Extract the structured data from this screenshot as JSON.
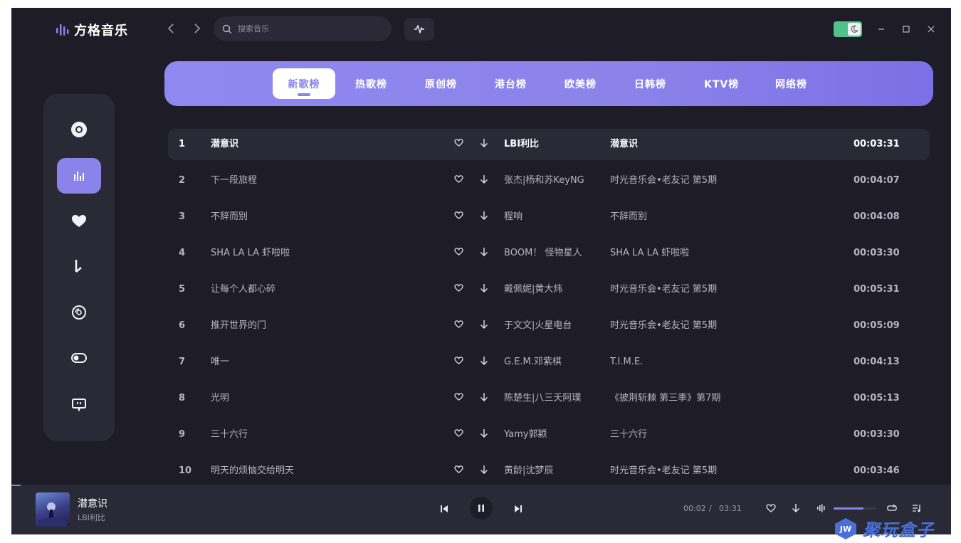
{
  "app": {
    "title": "方格音乐"
  },
  "search": {
    "placeholder": "搜索音乐"
  },
  "tabs": [
    "新歌榜",
    "热歌榜",
    "原创榜",
    "港台榜",
    "欧美榜",
    "日韩榜",
    "KTV榜",
    "网络榜"
  ],
  "active_tab": "新歌榜",
  "sidebar": {
    "items": [
      {
        "icon": "disc-icon"
      },
      {
        "icon": "chart-bars-icon",
        "active": true
      },
      {
        "icon": "heart-icon"
      },
      {
        "icon": "music-note-icon"
      },
      {
        "icon": "cd-icon"
      },
      {
        "icon": "toggle-icon"
      },
      {
        "icon": "bilibili-icon"
      }
    ]
  },
  "songs": [
    {
      "idx": "1",
      "title": "潜意识",
      "artist": "LBI利比",
      "album": "潜意识",
      "duration": "00:03:31",
      "current": true
    },
    {
      "idx": "2",
      "title": "下一段旅程",
      "artist": "张杰|杨和苏KeyNG",
      "album": "时光音乐会•老友记 第5期",
      "duration": "00:04:07"
    },
    {
      "idx": "3",
      "title": "不辞而别",
      "artist": "程响",
      "album": "不辞而别",
      "duration": "00:04:08"
    },
    {
      "idx": "4",
      "title": "SHA LA LA 虾啦啦",
      "artist": "BOOM！ 怪物星人",
      "album": "SHA LA LA 虾啦啦",
      "duration": "00:03:30"
    },
    {
      "idx": "5",
      "title": "让每个人都心碎",
      "artist": "戴佩妮|黄大炜",
      "album": "时光音乐会•老友记 第5期",
      "duration": "00:05:31"
    },
    {
      "idx": "6",
      "title": "推开世界的门",
      "artist": "于文文|火星电台",
      "album": "时光音乐会•老友记 第5期",
      "duration": "00:05:09"
    },
    {
      "idx": "7",
      "title": "唯一",
      "artist": "G.E.M.邓紫棋",
      "album": "T.I.M.E.",
      "duration": "00:04:13"
    },
    {
      "idx": "8",
      "title": "光明",
      "artist": "陈楚生|八三夭阿璞",
      "album": "《披荆斩棘 第三季》第7期",
      "duration": "00:05:13"
    },
    {
      "idx": "9",
      "title": "三十六行",
      "artist": "Yamy郭颖",
      "album": "三十六行",
      "duration": "00:03:30"
    },
    {
      "idx": "10",
      "title": "明天的烦恼交给明天",
      "artist": "黄龄|沈梦辰",
      "album": "时光音乐会•老友记 第5期",
      "duration": "00:03:46"
    }
  ],
  "player": {
    "song": "潜意识",
    "artist": "LBI利比",
    "current_time": "00:02",
    "separator": "/",
    "total_time": "03:31",
    "progress": 0.01,
    "volume": 0.7
  },
  "watermark": {
    "text": "聚玩盒子",
    "badge": "JW"
  },
  "colors": {
    "accent": "#8a83ea",
    "background": "#1e1d27",
    "panel": "#2a2a36",
    "toggle": "#4fc38b"
  }
}
